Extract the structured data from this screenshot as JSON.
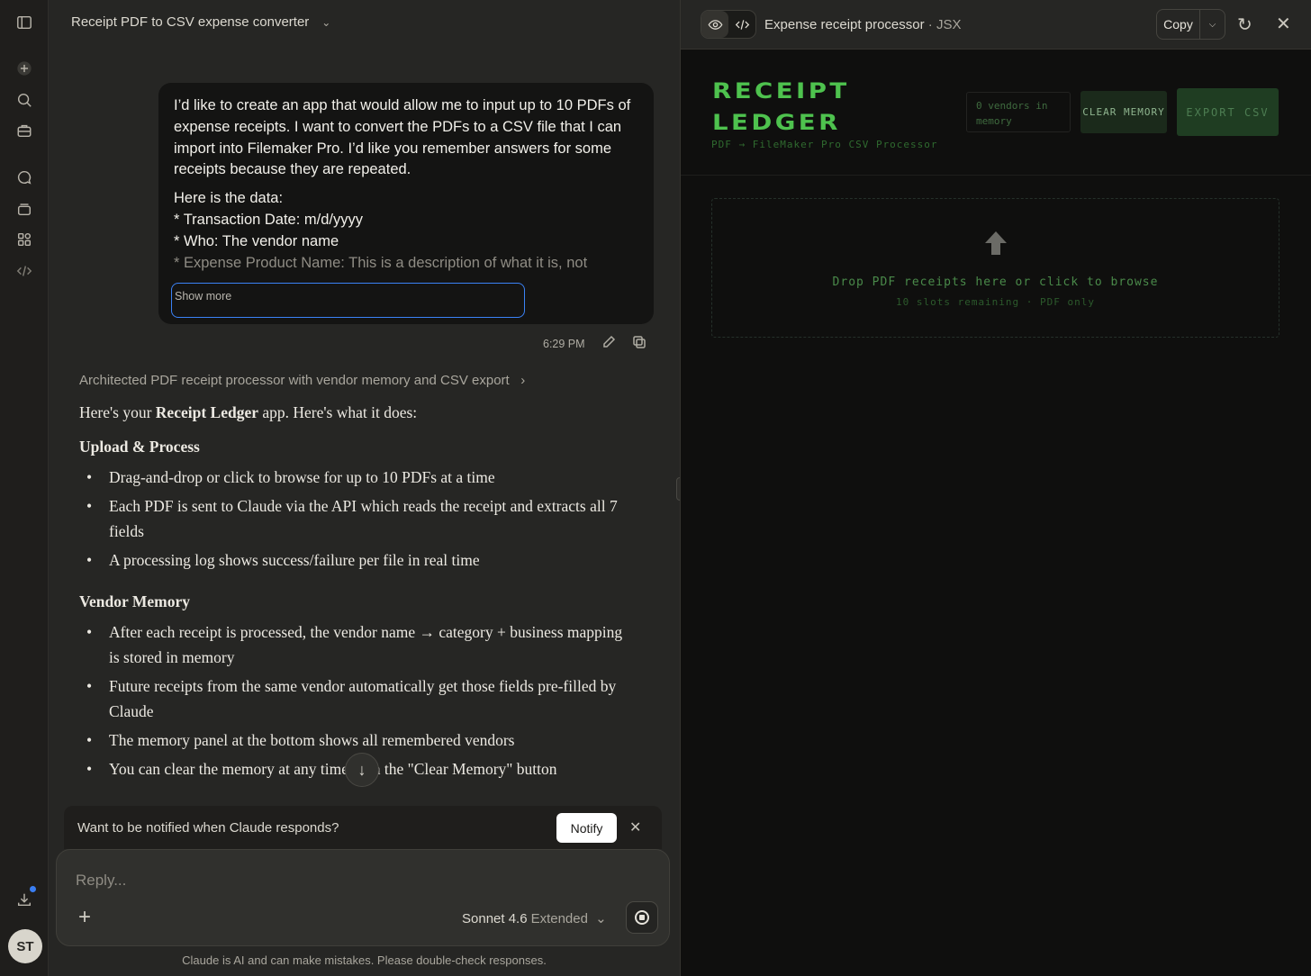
{
  "sidebar": {
    "icons": [
      "sidebar-toggle-icon",
      "new-chat-icon",
      "search-icon",
      "projects-icon",
      "chats-icon",
      "artifacts-stack-icon",
      "apps-grid-icon",
      "code-icon",
      "download-icon"
    ],
    "avatar_initials": "ST"
  },
  "chat": {
    "title": "Receipt PDF to CSV expense converter",
    "user_message": {
      "para1": "I’d like to create an app that would allow me to input up to 10 PDFs of expense receipts.  I want to convert the PDFs to a CSV file that I can import into Filemaker Pro. I’d like you remember answers for some receipts because they are repeated.",
      "line1": "Here is the data:",
      "line2": "* Transaction Date: m/d/yyyy",
      "line3": "* Who: The vendor name",
      "line4": "* Expense Product Name: This is a description of what it is, not",
      "show_more": "Show more",
      "time": "6:29 PM"
    },
    "thinking_summary": "Architected PDF receipt processor with vendor memory and CSV export",
    "response": {
      "lead_pre": "Here's your ",
      "lead_bold": "Receipt Ledger",
      "lead_post": " app. Here's what it does:",
      "section1_title": "Upload & Process",
      "section1_items": [
        "Drag-and-drop or click to browse for up to 10 PDFs at a time",
        "Each PDF is sent to Claude via the API which reads the receipt and extracts all 7 fields",
        "A processing log shows success/failure per file in real time"
      ],
      "section2_title": "Vendor Memory",
      "section2_items": [
        "After each receipt is processed, the vendor name → category + business mapping is stored in memory",
        "Future receipts from the same vendor automatically get those fields pre-filled by Claude",
        "The memory panel at the bottom shows all remembered vendors",
        "You can clear the memory at any time with the \"Clear Memory\" button"
      ]
    },
    "notify": {
      "text": "Want to be notified when Claude responds?",
      "button": "Notify"
    },
    "composer": {
      "placeholder": "Reply...",
      "model": "Sonnet 4.6",
      "mode": "Extended"
    },
    "disclaimer": "Claude is AI and can make mistakes. Please double-check responses."
  },
  "artifact": {
    "title": "Expense receipt processor",
    "type": "JSX",
    "copy_label": "Copy",
    "app": {
      "brand_line1": "RECEIPT",
      "brand_line2": "LEDGER",
      "subtitle": "PDF → FileMaker Pro CSV Processor",
      "vendors_in_memory": "0 vendors in memory",
      "clear_button": "CLEAR MEMORY",
      "export_button": "EXPORT CSV",
      "drop_text": "Drop PDF receipts here or click to browse",
      "drop_sub": "10 slots remaining · PDF only"
    },
    "colors": {
      "accent_green": "#4ec24e",
      "panel_bg": "#0f0f0e"
    }
  }
}
